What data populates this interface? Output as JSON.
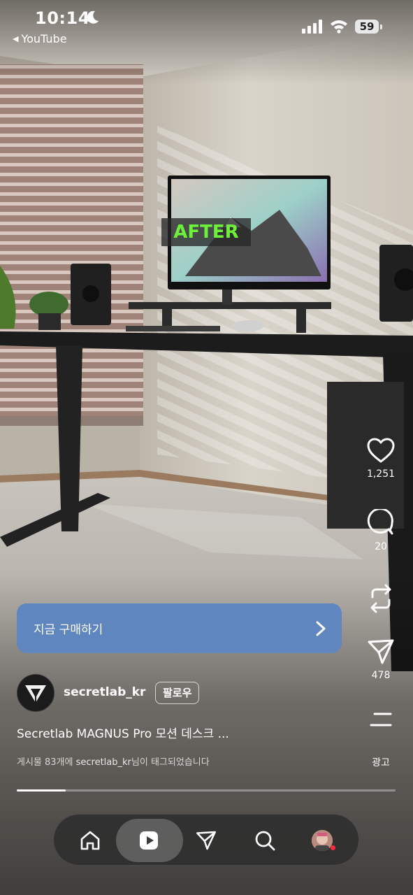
{
  "status_bar": {
    "time": "10:14",
    "back_app": "YouTube",
    "battery": "59"
  },
  "video_overlay": {
    "label": "AFTER"
  },
  "actions": {
    "likes": "1,251",
    "comments": "20",
    "shares": "478",
    "ad_label": "광고"
  },
  "cta": {
    "label": "지금 구매하기"
  },
  "account": {
    "username": "secretlab_kr",
    "follow_label": "팔로우"
  },
  "caption": "Secretlab MAGNUS Pro 모션 데스크 ...",
  "tagged": {
    "prefix": "게시물 83개에 ",
    "user": "secretlab_kr",
    "suffix": "님이 태그되었습니다"
  },
  "progress": {
    "fraction": 0.13
  },
  "colors": {
    "cta": "#5f86be",
    "after_text": "#6df03a",
    "notification_dot": "#ff2a3d"
  },
  "icons": [
    "moon-icon",
    "signal-icon",
    "wifi-icon",
    "heart-icon",
    "comment-icon",
    "repost-icon",
    "send-icon",
    "more-icon",
    "chevron-right-icon",
    "home-icon",
    "reels-icon",
    "send-nav-icon",
    "search-icon"
  ]
}
